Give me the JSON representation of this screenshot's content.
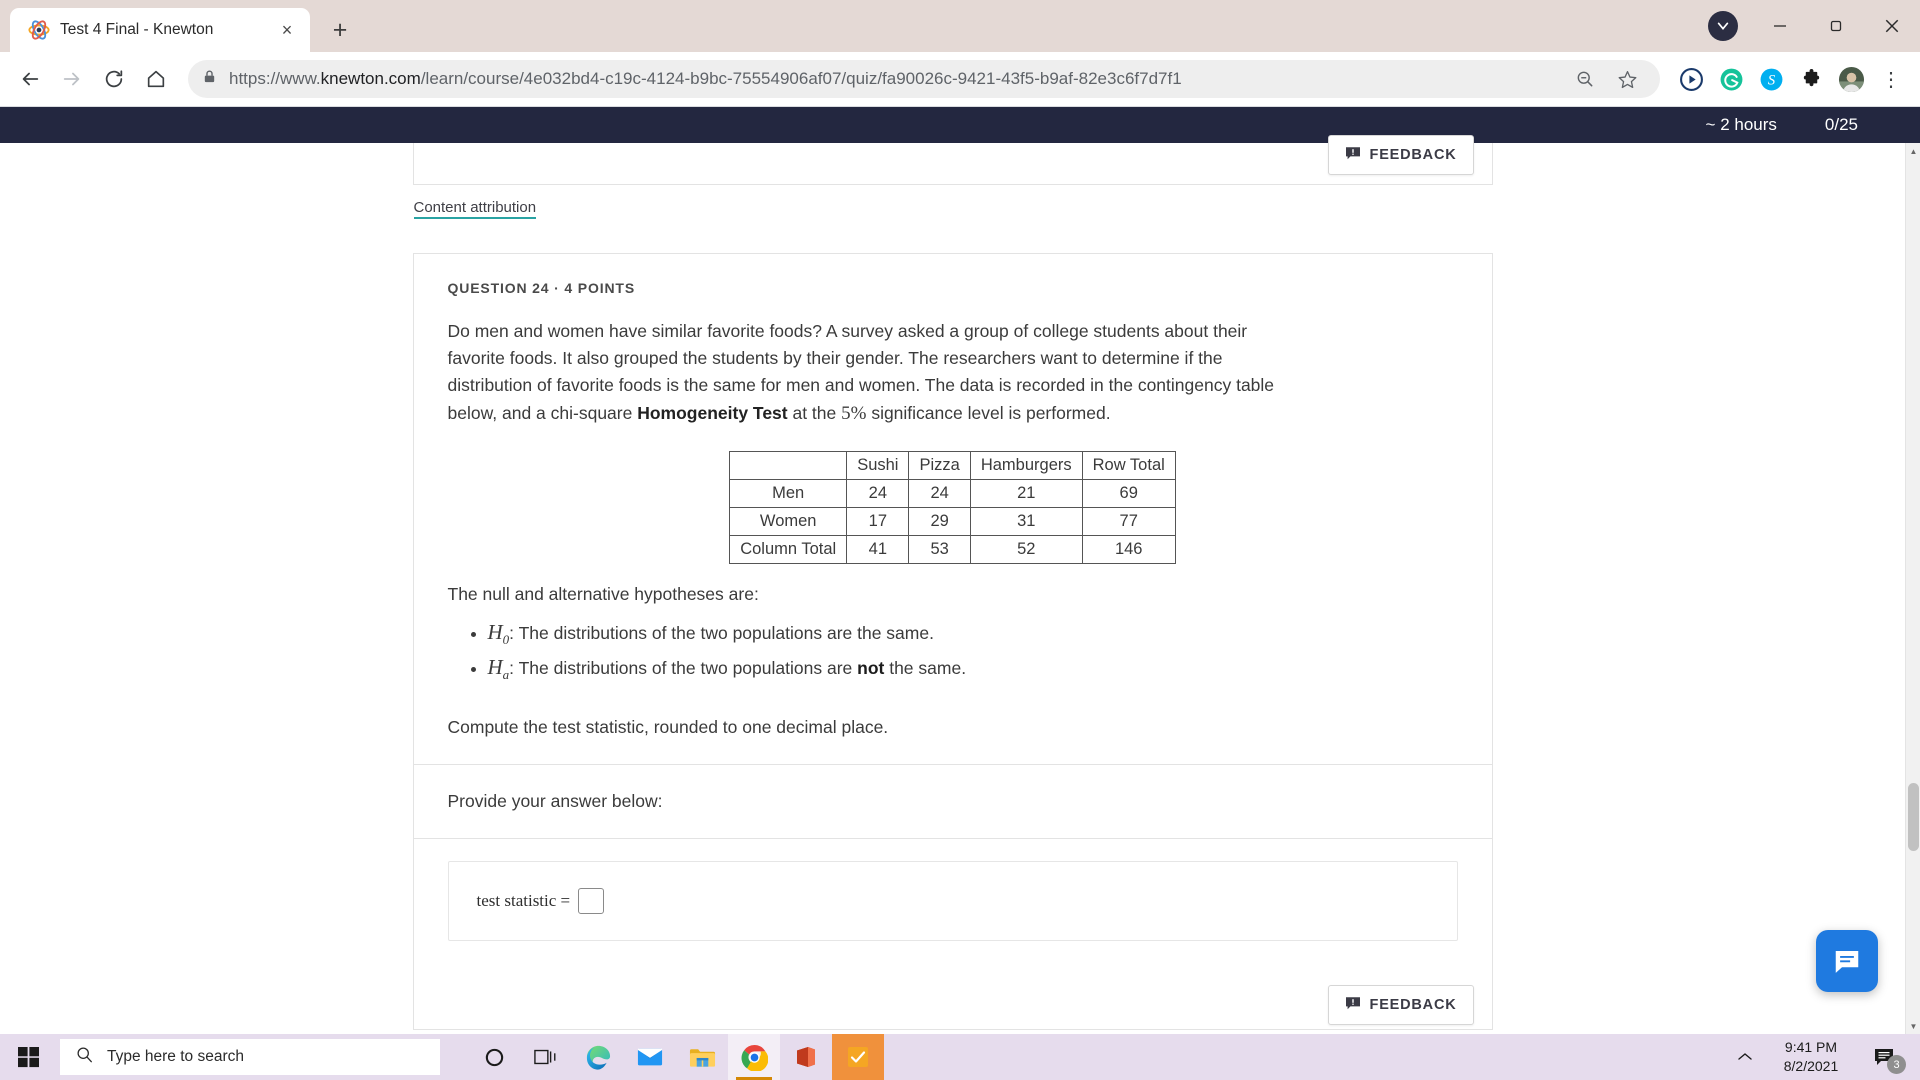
{
  "browser": {
    "tab": {
      "title": "Test 4 Final - Knewton",
      "favicon": "knewton-atom-icon",
      "close": "×",
      "newtab": "+"
    },
    "window_controls": {
      "minimize": "—",
      "maximize": "❐",
      "close": "✕"
    },
    "toolbar": {
      "back": "←",
      "forward": "→",
      "reload": "⟳",
      "home": "⌂",
      "url_scheme": "https://www.",
      "url_host": "knewton.com",
      "url_path": "/learn/course/4e032bd4-c19c-4124-b9bc-75554906af07/quiz/fa90026c-9421-43f5-b9af-82e3c6f7d7f1",
      "zoom_out_icon": "zoom-out-icon",
      "bookmark_icon": "star-icon",
      "extensions": [
        "play-button-extension-icon",
        "grammarly-extension-icon",
        "skype-extension-icon",
        "puzzle-extensions-icon"
      ],
      "avatar": "profile-avatar",
      "menu": "⋮"
    }
  },
  "quizbar": {
    "time_remaining": "~ 2 hours",
    "progress": "0/25"
  },
  "top_card": {
    "feedback_label": "FEEDBACK",
    "feedback_icon": "feedback-comment-icon"
  },
  "attribution": {
    "label": "Content attribution"
  },
  "question": {
    "meta": "QUESTION 24  ·  4 POINTS",
    "paragraph_part1": "Do men and women have similar favorite foods? A survey asked a group of college students about their favorite foods. It also grouped the students by their gender. The researchers want to determine if the distribution of favorite foods is the same for men and women. The data is recorded in the contingency table below, and a chi-square ",
    "paragraph_bold": "Homogeneity Test",
    "paragraph_part2": " at the ",
    "paragraph_math": "5%",
    "paragraph_part3": " significance level is performed.",
    "hypotheses_lead": "The null and alternative hypotheses are:",
    "hypotheses": [
      {
        "symbol": "H",
        "sub": "0",
        "text_before": ": The distributions of the two populations are the same.",
        "bold": "",
        "text_after": ""
      },
      {
        "symbol": "H",
        "sub": "a",
        "text_before": ": The distributions of the two populations are ",
        "bold": "not",
        "text_after": " the same."
      }
    ],
    "compute": "Compute the test statistic, rounded to one decimal place.",
    "provide": "Provide your answer below:",
    "answer_label": "test statistic =",
    "answer_value": ""
  },
  "chart_data": {
    "type": "table",
    "title": "Contingency table of favorite foods by gender",
    "columns": [
      "",
      "Sushi",
      "Pizza",
      "Hamburgers",
      "Row Total"
    ],
    "rows": [
      {
        "label": "Men",
        "values": [
          24,
          24,
          21,
          69
        ]
      },
      {
        "label": "Women",
        "values": [
          17,
          29,
          31,
          77
        ]
      },
      {
        "label": "Column Total",
        "values": [
          41,
          53,
          52,
          146
        ]
      }
    ]
  },
  "bottom_card": {
    "feedback_label": "FEEDBACK",
    "feedback_icon": "feedback-comment-icon"
  },
  "chat": {
    "icon": "chat-bubble-icon"
  },
  "taskbar": {
    "start": "windows-start-icon",
    "search_placeholder": "Type here to search",
    "search_icon": "search-icon",
    "icons": [
      "cortana-icon",
      "task-view-icon",
      "edge-browser-icon",
      "mail-icon",
      "file-explorer-icon",
      "chrome-browser-icon",
      "office-icon",
      "todo-icon"
    ],
    "tray_chevron": "^",
    "time": "9:41 PM",
    "date": "8/2/2021",
    "notification_count": "3",
    "notification_icon": "notification-icon"
  },
  "colors": {
    "quizbar_bg": "#232740",
    "accent_underline": "#29a3a3",
    "chat_fab": "#1f7ae0",
    "taskbar_bg": "#e6dced"
  }
}
